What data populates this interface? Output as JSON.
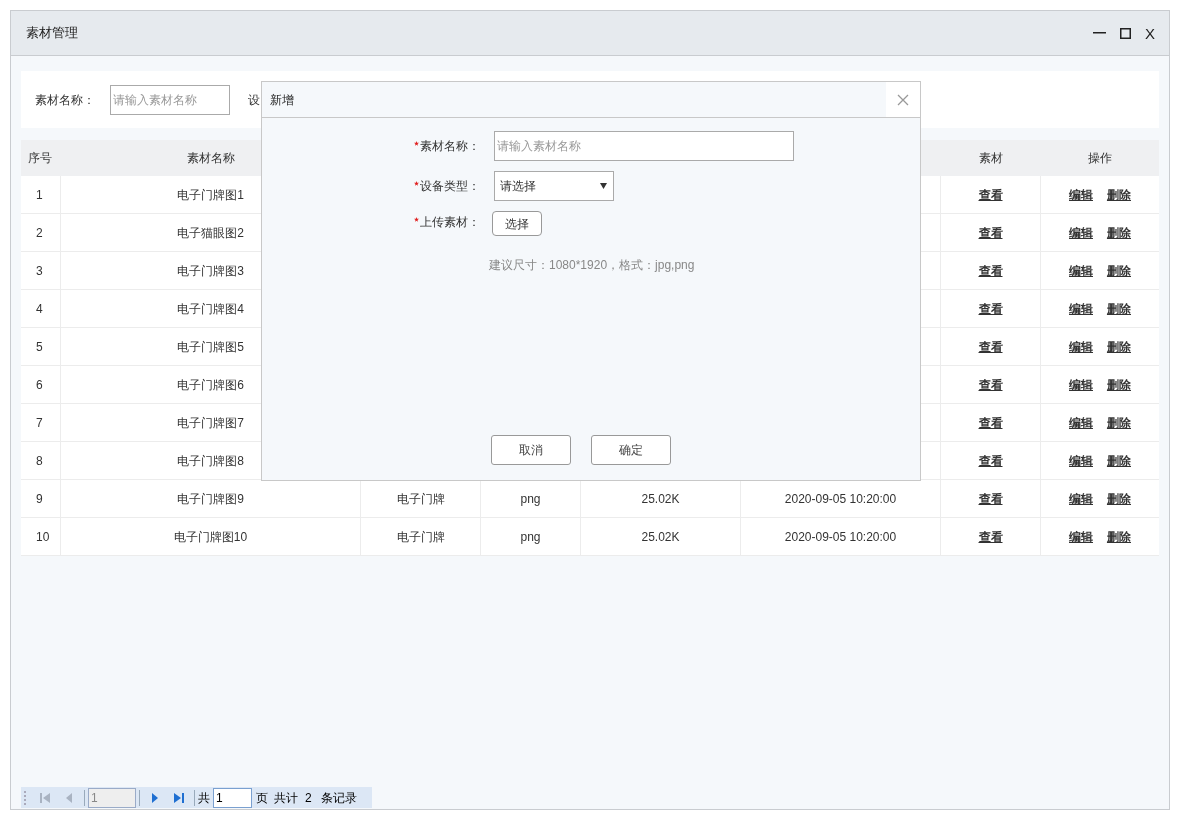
{
  "window": {
    "title": "素材管理",
    "close": "X"
  },
  "filter": {
    "label": "素材名称：",
    "placeholder": "请输入素材名称",
    "label_2": "设"
  },
  "table": {
    "header_left": [
      "序号",
      "素材名称"
    ],
    "header_right": [
      "素材",
      "操作"
    ],
    "rows": [
      {
        "index": "1",
        "name": "电子门牌图1",
        "view": "查看",
        "edit": "编辑",
        "delete": "删除"
      },
      {
        "index": "2",
        "name": "电子猫眼图2",
        "view": "查看",
        "edit": "编辑",
        "delete": "删除"
      },
      {
        "index": "3",
        "name": "电子门牌图3",
        "view": "查看",
        "edit": "编辑",
        "delete": "删除"
      },
      {
        "index": "4",
        "name": "电子门牌图4",
        "view": "查看",
        "edit": "编辑",
        "delete": "删除"
      },
      {
        "index": "5",
        "name": "电子门牌图5",
        "view": "查看",
        "edit": "编辑",
        "delete": "删除"
      },
      {
        "index": "6",
        "name": "电子门牌图6",
        "view": "查看",
        "edit": "编辑",
        "delete": "删除"
      },
      {
        "index": "7",
        "name": "电子门牌图7",
        "view": "查看",
        "edit": "编辑",
        "delete": "删除"
      },
      {
        "index": "8",
        "name": "电子门牌图8",
        "view": "查看",
        "edit": "编辑",
        "delete": "删除"
      },
      {
        "index": "9",
        "name": "电子门牌图9",
        "type": "电子门牌",
        "format": "png",
        "size": "25.02K",
        "time": "2020-09-05 10:20:00",
        "view": "查看",
        "edit": "编辑",
        "delete": "删除"
      },
      {
        "index": "10",
        "name": "电子门牌图10",
        "type": "电子门牌",
        "format": "png",
        "size": "25.02K",
        "time": "2020-09-05 10:20:00",
        "view": "查看",
        "edit": "编辑",
        "delete": "删除"
      }
    ]
  },
  "dialog": {
    "title": "新增",
    "fields": [
      {
        "kind": "text",
        "label": "素材名称：",
        "placeholder": "请输入素材名称",
        "required": true
      },
      {
        "kind": "select",
        "label": "设备类型：",
        "value": "请选择",
        "required": true
      },
      {
        "kind": "upload",
        "label": "上传素材：",
        "button": "选择",
        "required": true
      }
    ],
    "hint": "建议尺寸：1080*1920，格式：jpg,png",
    "buttons": [
      "取消",
      "确定"
    ]
  },
  "pagination": {
    "nav_left": [
      {
        "kind": "first",
        "disabled": true
      },
      {
        "kind": "prev",
        "disabled": true
      }
    ],
    "page_input": "1",
    "nav_right": [
      {
        "kind": "next",
        "disabled": false
      },
      {
        "kind": "last",
        "disabled": false
      }
    ],
    "of_label": "共",
    "total_pages": "1",
    "page_label": "页",
    "total_label": "共计",
    "total": "2",
    "records_label": "条记录"
  }
}
